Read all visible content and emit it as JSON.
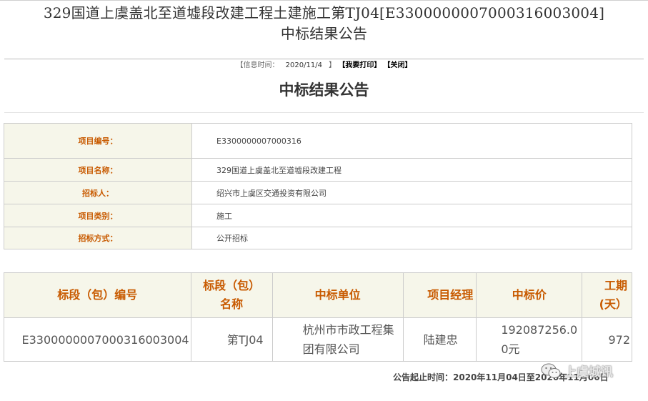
{
  "document": {
    "title_line1": "329国道上虞盖北至道墟段改建工程土建施工第TJ04[E3300000007000316003004]",
    "title_line2": "中标结果公告",
    "info": {
      "date_label": "【信息时间：",
      "date_value": "2020/11/4",
      "date_close": "】",
      "print_link": "【我要打印】",
      "close_link": "【关闭】"
    },
    "heading": "中标结果公告"
  },
  "project_info": [
    {
      "label": "项目编号：",
      "value": "E3300000007000316"
    },
    {
      "label": "项目名称：",
      "value": "329国道上虞盖北至道墟段改建工程"
    },
    {
      "label": "招标人：",
      "value": "绍兴市上虞区交通投资有限公司"
    },
    {
      "label": "项目类别：",
      "value": "施工"
    },
    {
      "label": "招标方式：",
      "value": "公开招标"
    }
  ],
  "bid_table": {
    "headers": [
      "标段（包）编号",
      "标段（包）名称",
      "中标单位",
      "项目经理",
      "中标价",
      "工期(天）"
    ],
    "rows": [
      [
        "E3300000007000316003004",
        "第TJ04",
        "杭州市市政工程集团有限公司",
        "陆建忠",
        "192087256.00元",
        "972"
      ]
    ]
  },
  "deadline": "公告起止时间：2020年11月04日至2020年11月06日",
  "watermark": "上虞城讯"
}
